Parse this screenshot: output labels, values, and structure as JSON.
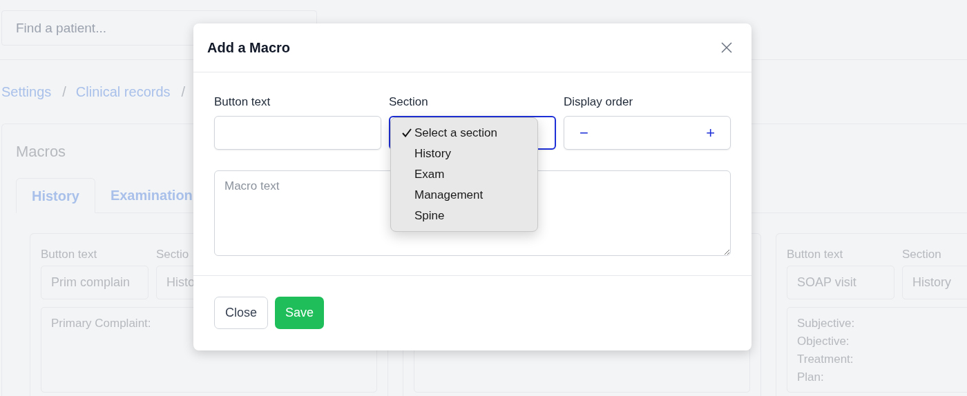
{
  "search": {
    "placeholder": "Find a patient..."
  },
  "breadcrumb": [
    {
      "label": "Settings",
      "separator": "/"
    },
    {
      "label": "Clinical records",
      "separator": "/"
    }
  ],
  "panel": {
    "title": "Macros",
    "tabs": [
      {
        "label": "History",
        "selected": true
      },
      {
        "label": "Examination",
        "selected": false
      }
    ],
    "macros": [
      {
        "kind": "full",
        "button_text_label": "Button text",
        "button_text": "Prim complain",
        "section_label": "Sectio",
        "section": "Histo",
        "macro_text": [
          "Primary Complaint:"
        ]
      },
      {
        "kind": "covered"
      },
      {
        "kind": "full",
        "button_text_label": "Button text",
        "button_text": "SOAP visit",
        "section_label": "Section",
        "section": "History",
        "macro_text": [
          "Subjective:",
          "Objective:",
          "Treatment:",
          "Plan:"
        ]
      }
    ]
  },
  "modal": {
    "title": "Add a Macro",
    "fields": [
      {
        "kind": "text",
        "label": "Button text"
      },
      {
        "kind": "select",
        "label": "Section",
        "focused": true,
        "open": true,
        "options": [
          {
            "label": "Select a section",
            "selected": true
          },
          {
            "label": "History",
            "selected": false
          },
          {
            "label": "Exam",
            "selected": false
          },
          {
            "label": "Management",
            "selected": false
          },
          {
            "label": "Spine",
            "selected": false
          }
        ]
      },
      {
        "kind": "stepper",
        "label": "Display order",
        "minus": "−",
        "plus": "+"
      }
    ],
    "textarea": {
      "placeholder": "Macro text"
    },
    "buttons": [
      {
        "kind": "secondary",
        "label": "Close"
      },
      {
        "kind": "primary",
        "label": "Save"
      }
    ]
  }
}
